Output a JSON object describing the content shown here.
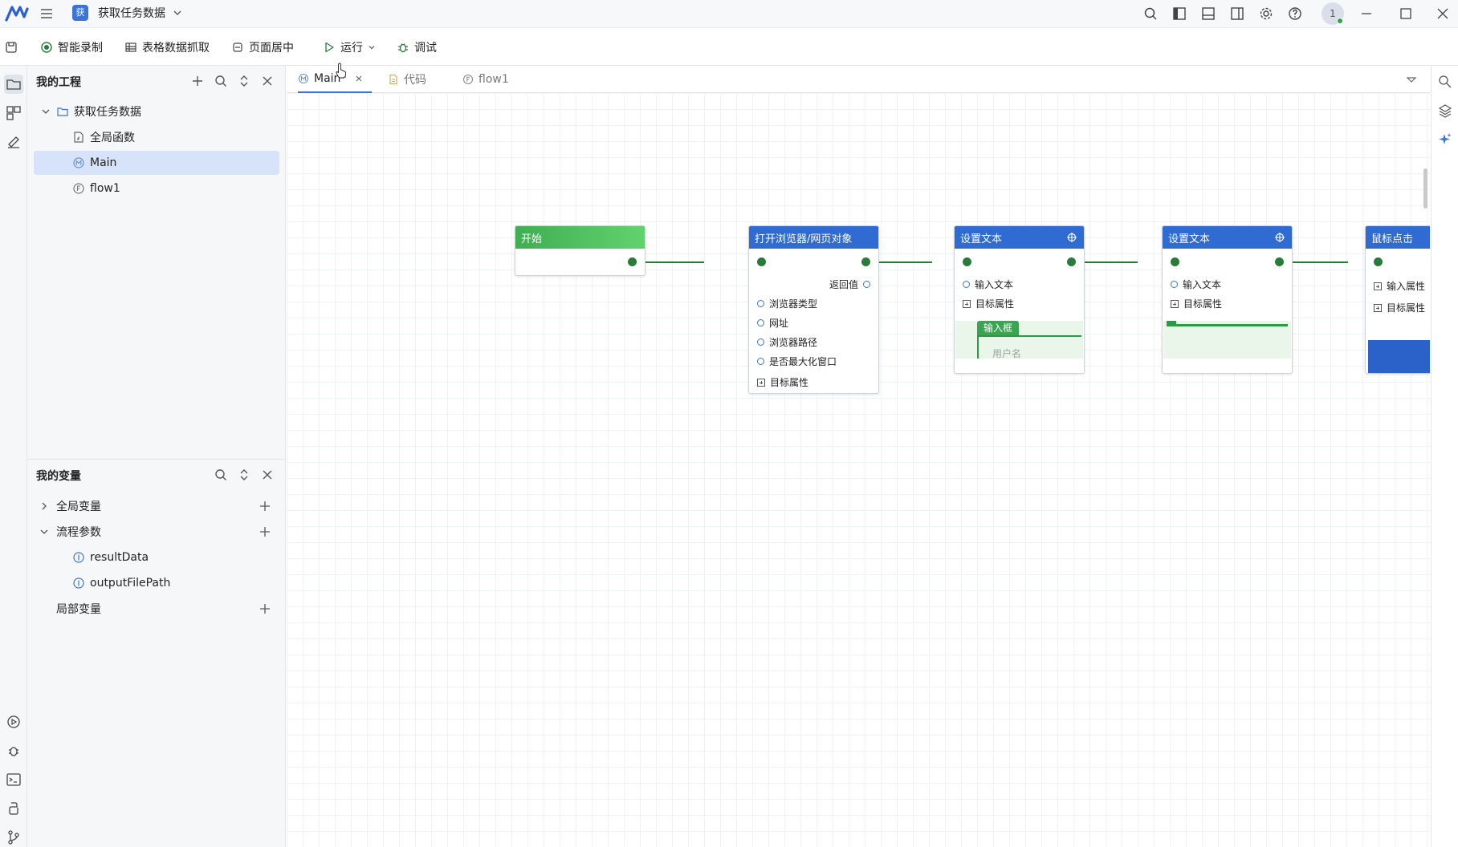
{
  "app": {
    "project_name": "获取任务数据",
    "project_badge": "获",
    "avatar_label": "1",
    "accent_color": "#3b74d8",
    "node_blue": "#2f6bd3",
    "node_green": "#3fae52",
    "edge_color": "#2a7a3b"
  },
  "toolbar": {
    "smart_record": "智能录制",
    "table_scrape": "表格数据抓取",
    "center_page": "页面居中",
    "run": "运行",
    "debug": "调试"
  },
  "project_panel": {
    "title": "我的工程",
    "tree": {
      "root": "获取任务数据",
      "global_functions": "全局函数",
      "main": "Main",
      "flow1": "flow1"
    }
  },
  "variables_panel": {
    "title": "我的变量",
    "global_vars": "全局变量",
    "flow_params": "流程参数",
    "param_1": "resultData",
    "param_2": "outputFilePath",
    "local_vars": "局部变量"
  },
  "editor_tabs": {
    "main": "Main*",
    "code": "代码",
    "flow1": "flow1"
  },
  "flow": {
    "start": {
      "title": "开始"
    },
    "open_browser": {
      "title": "打开浏览器/网页对象",
      "return_value": "返回值",
      "browser_type": "浏览器类型",
      "url": "网址",
      "browser_path": "浏览器路径",
      "maximize": "是否最大化窗口",
      "target_attr": "目标属性"
    },
    "set_text_1": {
      "title": "设置文本",
      "input_text": "输入文本",
      "target_attr": "目标属性",
      "preview_chip": "输入框",
      "preview_text": "用户名"
    },
    "set_text_2": {
      "title": "设置文本",
      "input_text": "输入文本",
      "target_attr": "目标属性"
    },
    "mouse_click": {
      "title": "鼠标点击",
      "input_attr": "输入属性",
      "target_attr": "目标属性"
    }
  }
}
